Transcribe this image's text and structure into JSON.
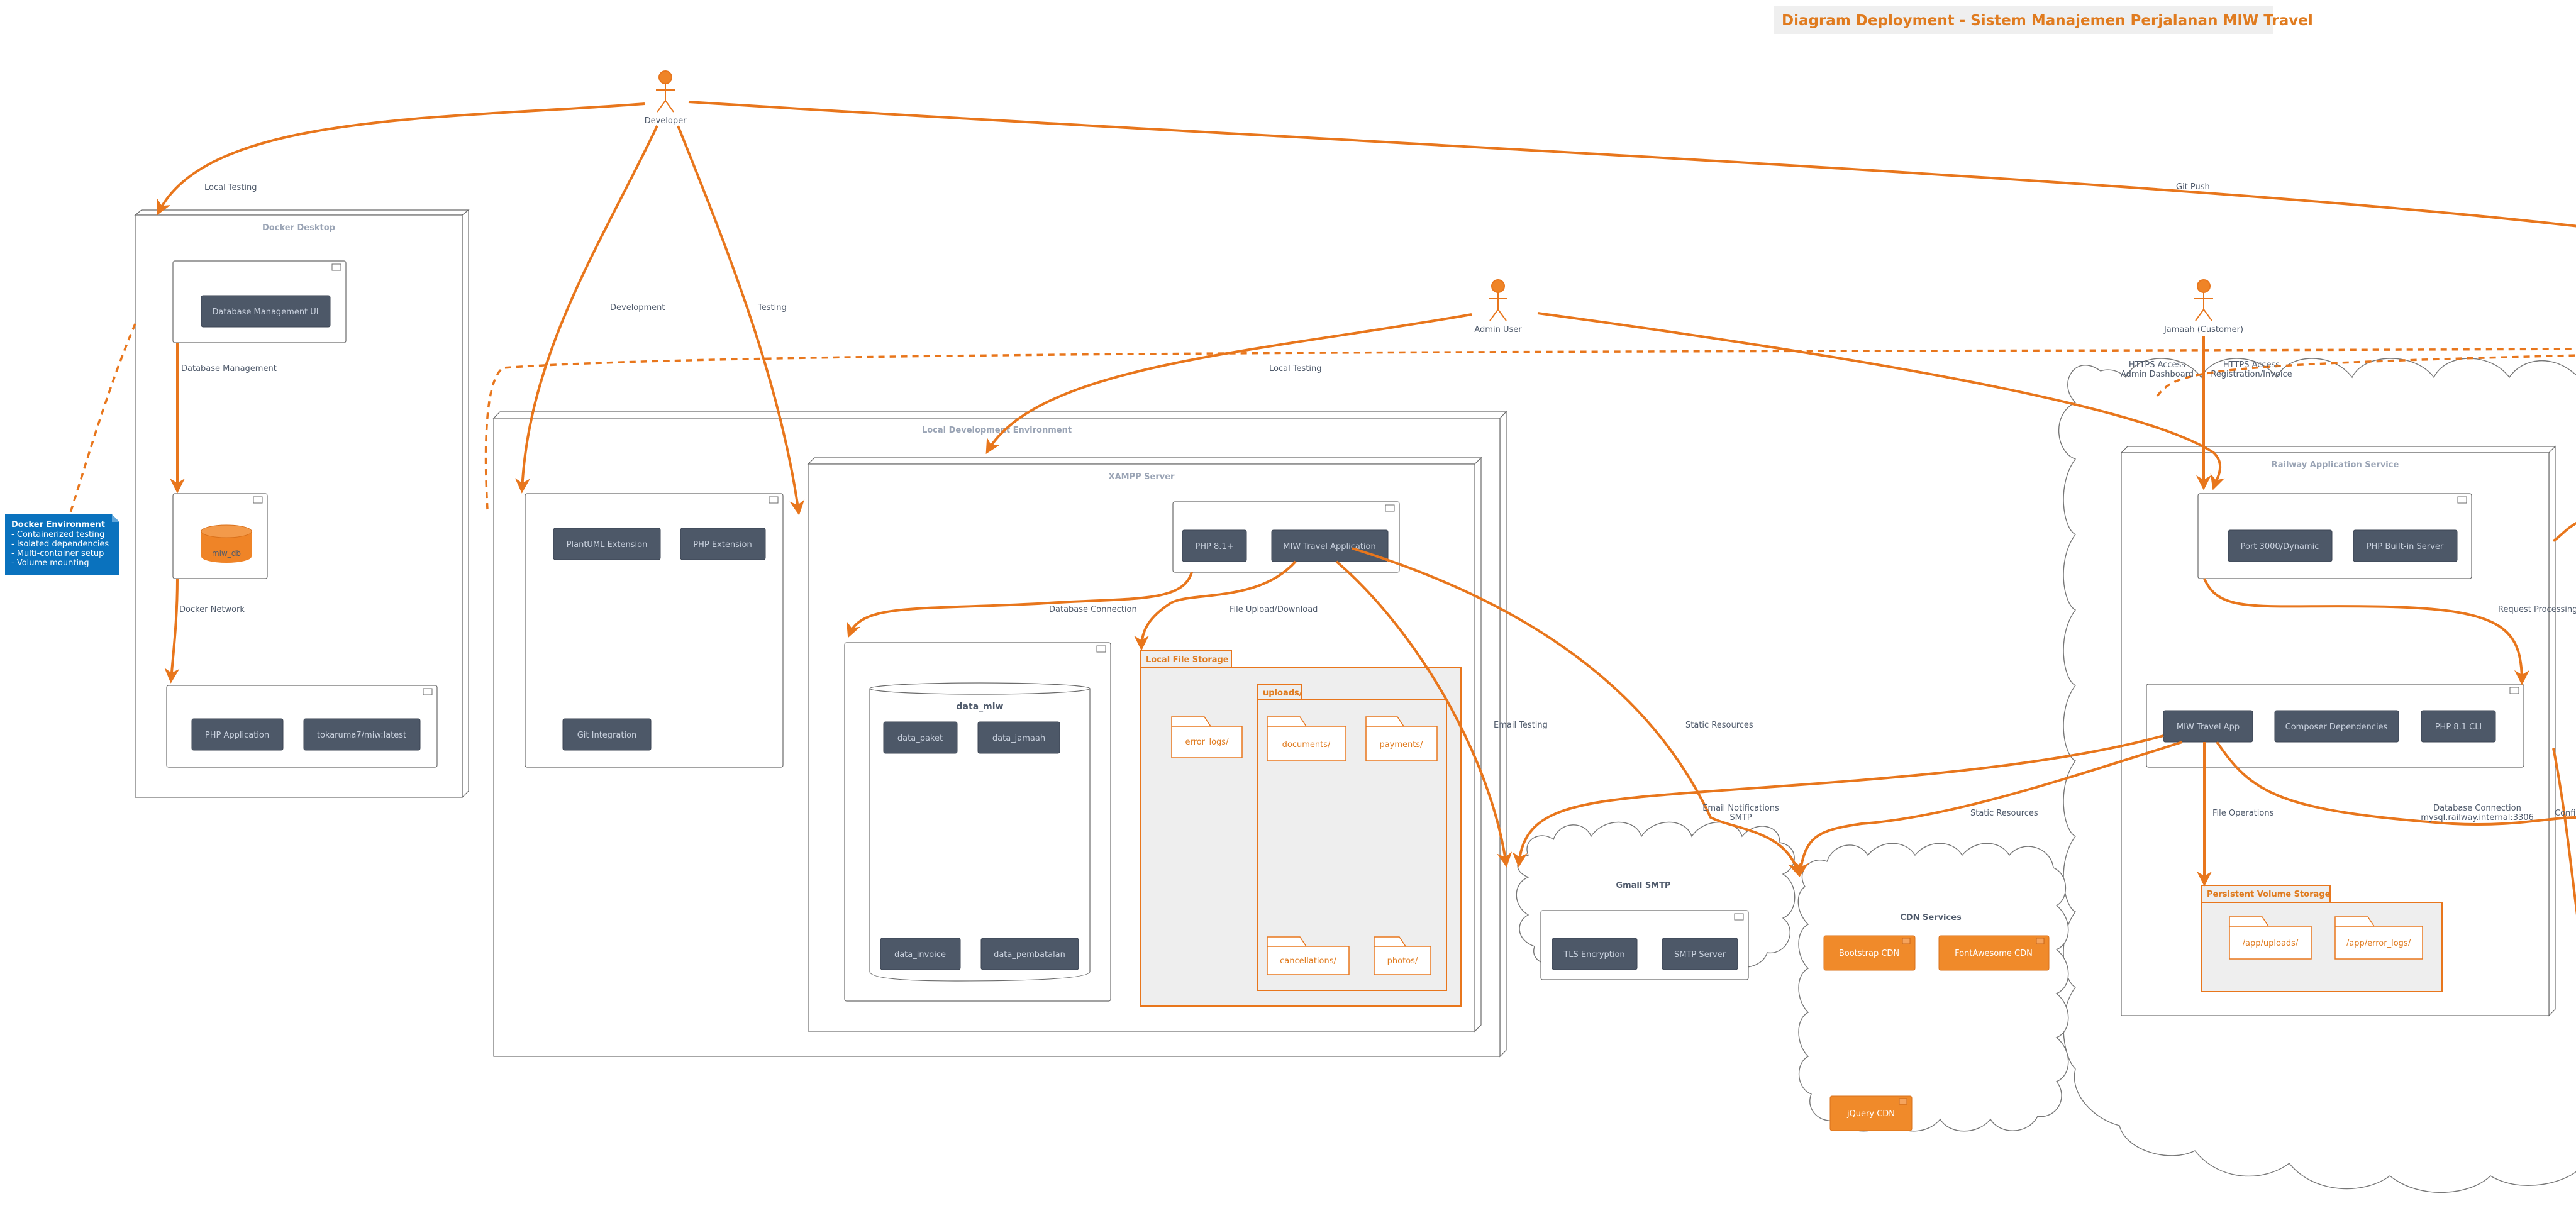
{
  "diagram": {
    "title": "Diagram Deployment - Sistem Manajemen Perjalanan MIW Travel",
    "actors": {
      "developer": "Developer",
      "admin": "Admin User",
      "customer": "Jamaah (Customer)"
    },
    "nodes": {
      "docker_desktop": "Docker Desktop",
      "local_env": "Local Development Environment",
      "xampp": "XAMPP Server",
      "railway_service": "Railway Application Service"
    },
    "clouds": {
      "gmail": "Gmail SMTP",
      "cdn": "CDN Services"
    },
    "packages": {
      "local_storage": "Local File Storage",
      "uploads": "uploads/",
      "persistent": "Persistent Volume Storage"
    },
    "database": "data_miw",
    "artifacts": {
      "db_mgmt_ui": "Database Management UI",
      "miw_db": "miw_db",
      "php_application": "PHP Application",
      "docker_image": "tokaruma7/miw:latest",
      "plantuml_ext": "PlantUML Extension",
      "php_ext": "PHP Extension",
      "git_integration": "Git Integration",
      "php81_xampp": "PHP 8.1+",
      "miw_travel_application": "MIW Travel Application",
      "data_paket": "data_paket",
      "data_jamaah": "data_jamaah",
      "data_invoice": "data_invoice",
      "data_pembatalan": "data_pembatalan",
      "tls": "TLS Encryption",
      "smtp_server": "SMTP Server",
      "bootstrap_cdn": "Bootstrap CDN",
      "fontawesome_cdn": "FontAwesome CDN",
      "jquery_cdn": "jQuery CDN",
      "port": "Port 3000/Dynamic",
      "php_builtin": "PHP Built-in Server",
      "miw_travel_app": "MIW Travel App",
      "composer": "Composer Dependencies",
      "php81_cli": "PHP 8.1 CLI"
    },
    "folders": {
      "error_logs": "error_logs/",
      "documents": "documents/",
      "payments": "payments/",
      "cancellations": "cancellations/",
      "photos": "photos/",
      "app_uploads": "/app/uploads/",
      "app_error_logs": "/app/error_logs/"
    },
    "edges": {
      "local_testing_docker": "Local Testing",
      "development": "Development",
      "testing": "Testing",
      "git_push": "Git Push",
      "local_testing_admin": "Local Testing",
      "database_management": "Database Management",
      "docker_network": "Docker Network",
      "database_connection": "Database Connection",
      "file_upload": "File Upload/Download",
      "email_testing": "Email Testing",
      "static_resources_xampp": "Static Resources",
      "email_notifications_1": "Email Notifications",
      "email_notifications_2": "SMTP",
      "static_resources_railway": "Static Resources",
      "file_operations": "File Operations",
      "db_conn_railway_1": "Database Connection",
      "db_conn_railway_2": "mysql.railway.internal:3306",
      "https_admin_1": "HTTPS Access",
      "https_admin_2": "Admin Dashboard",
      "https_customer_1": "HTTPS Access",
      "https_customer_2": "Registration/Invoice",
      "request_processing": "Request Processing",
      "config_partial": "Confi"
    },
    "note": {
      "title": "Docker Environment",
      "lines": [
        "- Containerized testing",
        "- Isolated dependencies",
        "- Multi-container setup",
        "- Volume mounting"
      ]
    }
  }
}
